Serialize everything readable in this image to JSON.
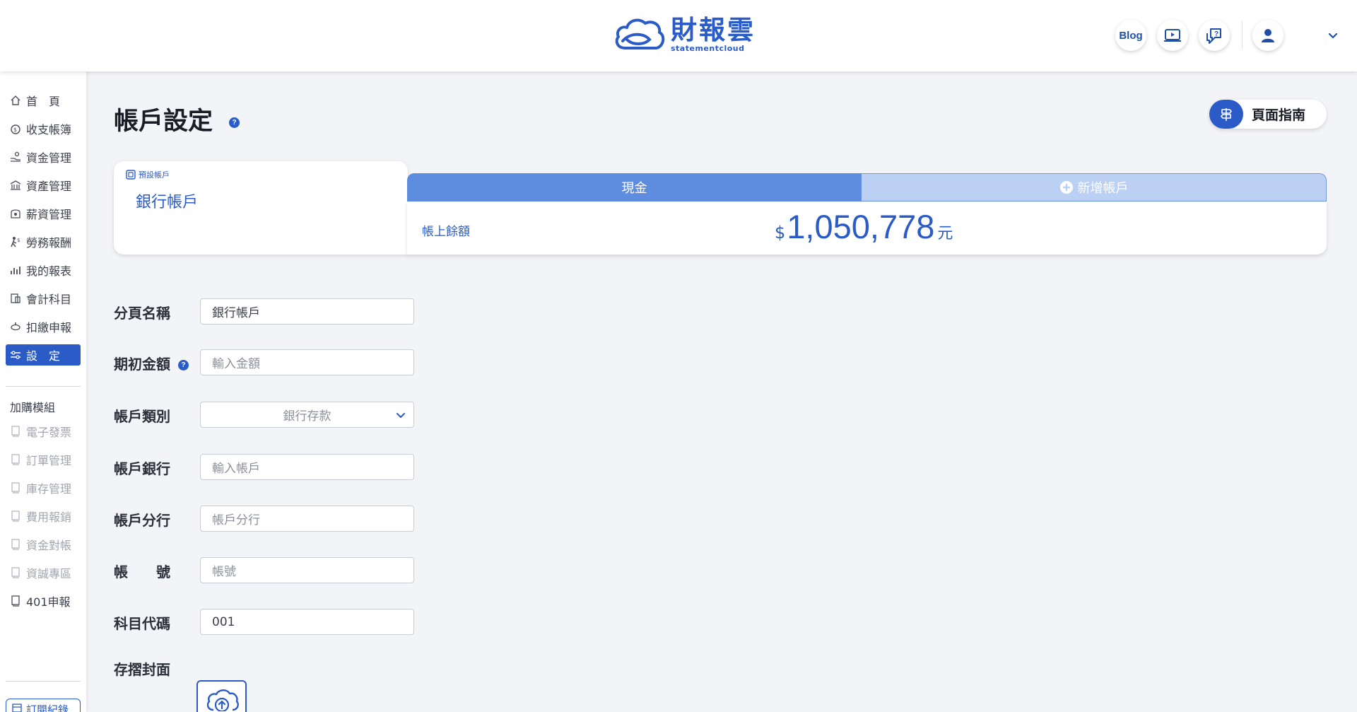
{
  "header": {
    "logo_text": "財報雲",
    "logo_subtext": "statementcloud",
    "blog_label": "Blog",
    "icons": [
      "video-tutorial-icon",
      "support-chat-icon",
      "user-avatar-icon",
      "chevron-down-icon"
    ]
  },
  "sidebar": {
    "items": [
      {
        "label": "首　頁",
        "icon": "home-icon"
      },
      {
        "label": "收支帳簿",
        "icon": "money-bag-icon"
      },
      {
        "label": "資金管理",
        "icon": "hand-coin-icon"
      },
      {
        "label": "資產管理",
        "icon": "building-icon"
      },
      {
        "label": "薪資管理",
        "icon": "wallet-icon"
      },
      {
        "label": "勞務報酬",
        "icon": "worker-icon"
      },
      {
        "label": "我的報表",
        "icon": "chart-icon"
      },
      {
        "label": "會計科目",
        "icon": "ledger-icon"
      },
      {
        "label": "扣繳申報",
        "icon": "stamp-icon"
      },
      {
        "label": "設　定",
        "icon": "sliders-icon"
      }
    ],
    "active_item": "設　定",
    "addon_heading": "加購模組",
    "addons": [
      {
        "label": "電子發票",
        "enabled": false
      },
      {
        "label": "訂單管理",
        "enabled": false
      },
      {
        "label": "庫存管理",
        "enabled": false
      },
      {
        "label": "費用報銷",
        "enabled": false
      },
      {
        "label": "資金對帳",
        "enabled": false
      },
      {
        "label": "資誠專區",
        "enabled": false
      },
      {
        "label": "401申報",
        "enabled": true
      }
    ],
    "bottom_button": "訂閱紀錄"
  },
  "page": {
    "title": "帳戶設定",
    "help_mark": "?",
    "guide_button": "頁面指南"
  },
  "account_card": {
    "default_tag": "預設帳戶",
    "default_name": "銀行帳戶",
    "tabs": [
      {
        "label": "現金",
        "selected": true
      },
      {
        "label": "新增帳戶",
        "selected": false
      }
    ],
    "balance_label": "帳上餘額",
    "currency_symbol": "$",
    "balance_value": "1,050,778",
    "balance_unit": "元"
  },
  "form": {
    "tab_name": {
      "label": "分頁名稱",
      "value": "銀行帳戶"
    },
    "opening_amount": {
      "label": "期初金額",
      "placeholder": "輸入金額"
    },
    "account_type": {
      "label": "帳戶類別",
      "selected": "銀行存款"
    },
    "bank": {
      "label": "帳戶銀行",
      "placeholder": "輸入帳戶"
    },
    "branch": {
      "label": "帳戶分行",
      "placeholder": "帳戶分行"
    },
    "account_no": {
      "label": "帳　　號",
      "placeholder": "帳號"
    },
    "subject_code": {
      "label": "科目代碼",
      "value": "001"
    },
    "passbook_cover": {
      "label": "存摺封面"
    }
  },
  "colors": {
    "accent": "#2a5bc7",
    "tab_selected": "#5e8de0",
    "tab_unselected": "#bcd0f3",
    "page_bg": "#f3f4f7"
  }
}
